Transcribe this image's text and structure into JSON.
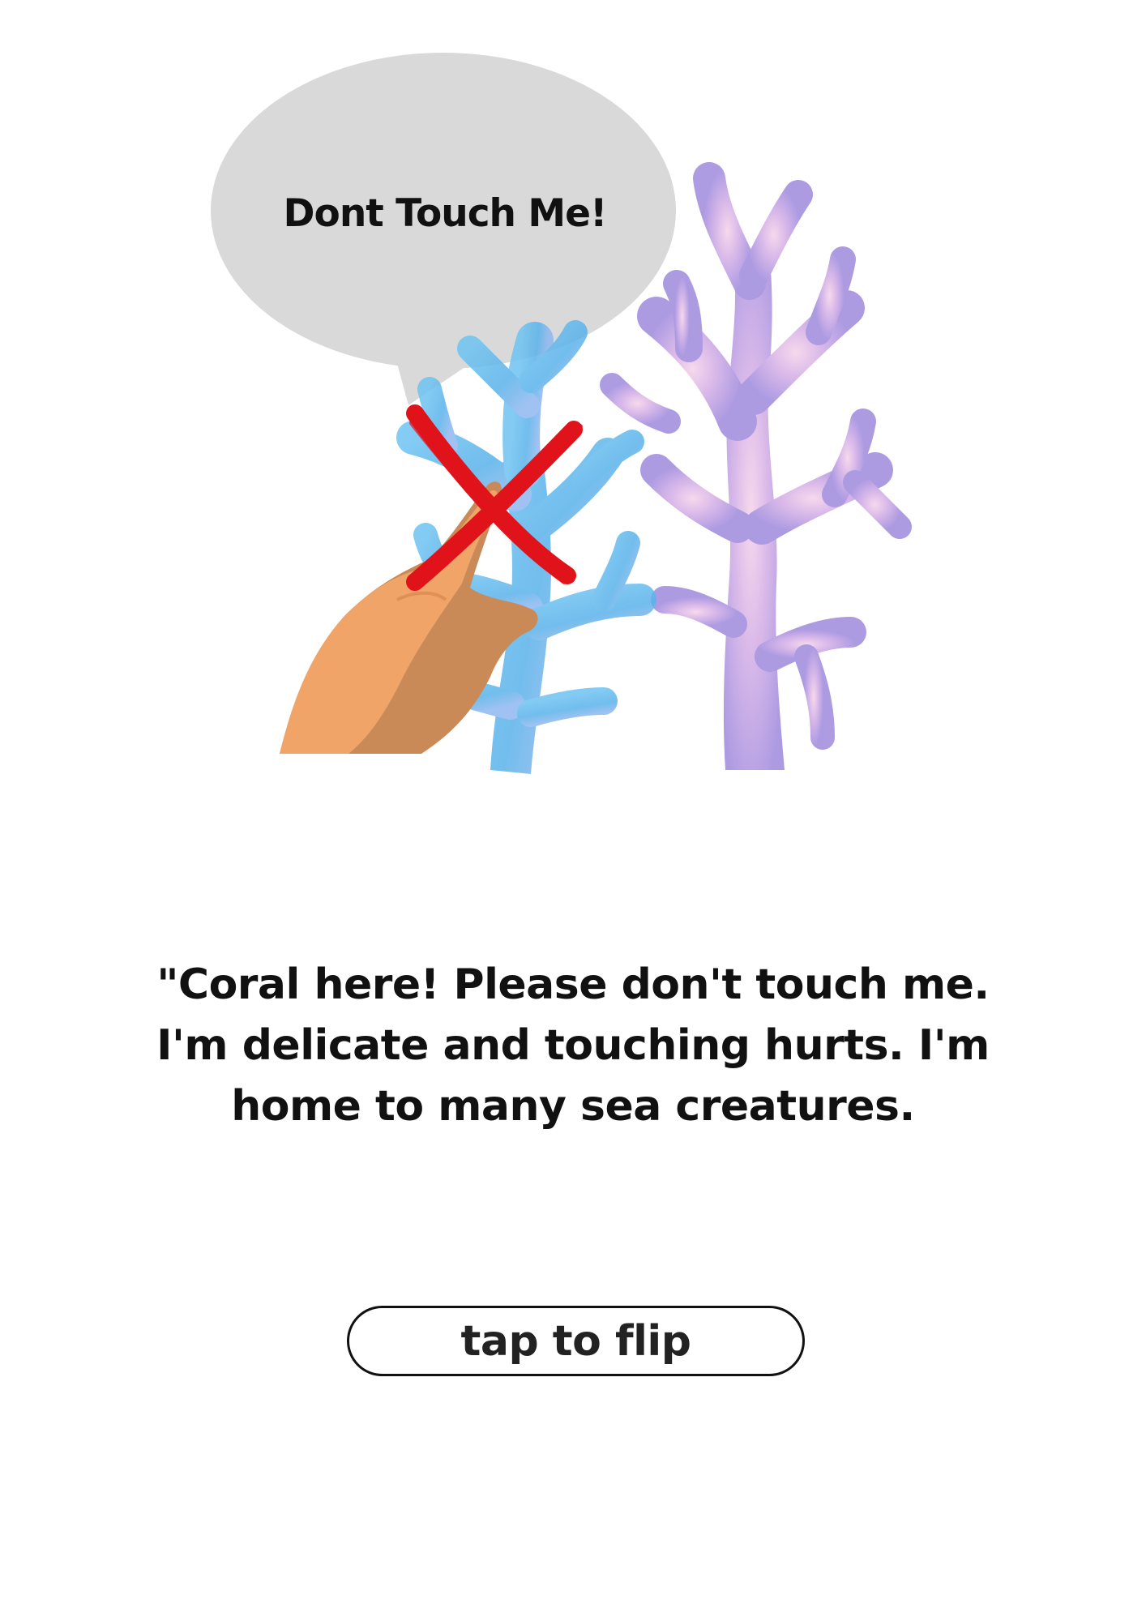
{
  "speech_bubble": {
    "text": "Dont Touch Me!"
  },
  "message": {
    "line1": "\"Coral here! Please don't touch me.",
    "line2": "I'm delicate and touching hurts. I'm",
    "line3": "home to many sea creatures."
  },
  "flip_button": {
    "label": "tap to flip"
  },
  "icons": [
    "speech-bubble-icon",
    "hand-pointing-icon",
    "red-x-icon",
    "blue-coral-icon",
    "purple-coral-icon"
  ],
  "colors": {
    "bubble": "#d9d9d9",
    "x_mark": "#e0131b",
    "skin": "#f0a468",
    "skin_shadow": "#c98a58",
    "coral_blue": "#5fb4ec",
    "coral_purple": "#b59be3",
    "text": "#111111"
  }
}
